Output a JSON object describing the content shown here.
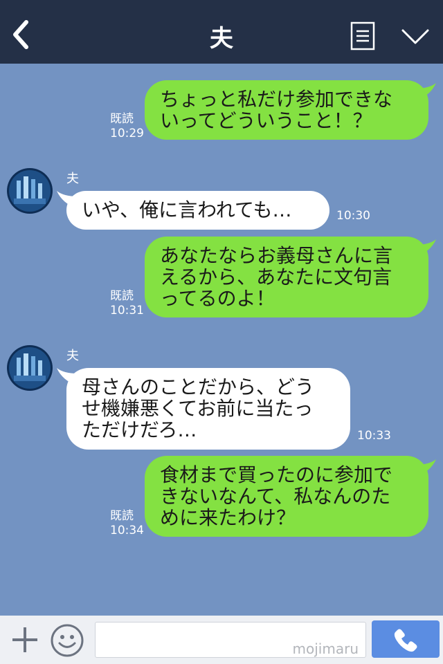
{
  "header": {
    "title": "夫",
    "back_icon": "chevron-left-icon",
    "menu_icon": "menu-list-icon",
    "collapse_icon": "chevron-down-icon"
  },
  "messages": [
    {
      "direction": "sent",
      "lines": [
        "ちょっと私だけ参加できな",
        "いってどういうこと！？"
      ],
      "read_label": "既読",
      "time": "10:29"
    },
    {
      "direction": "received",
      "sender": "夫",
      "lines": [
        "いや、俺に言われても…"
      ],
      "time": "10:30"
    },
    {
      "direction": "sent",
      "lines": [
        "あなたならお義母さんに言",
        "えるから、あなたに文句言",
        "ってるのよ！"
      ],
      "read_label": "既読",
      "time": "10:31"
    },
    {
      "direction": "received",
      "sender": "夫",
      "lines": [
        "母さんのことだから、どう",
        "せ機嫌悪くてお前に当たっ",
        "ただけだろ…"
      ],
      "time": "10:33"
    },
    {
      "direction": "sent",
      "lines": [
        "食材まで買ったのに参加で",
        "きないなんて、私なんのた",
        "めに来たわけ？"
      ],
      "read_label": "既読",
      "time": "10:34"
    }
  ],
  "footer": {
    "input_watermark": "mojimaru",
    "plus_icon": "plus-icon",
    "emoji_icon": "smiley-icon",
    "call_icon": "phone-icon"
  },
  "colors": {
    "header_bg": "#243047",
    "chat_bg": "#7393c2",
    "sent_bubble": "#84e142",
    "received_bubble": "#ffffff",
    "call_button": "#5b8de2"
  }
}
